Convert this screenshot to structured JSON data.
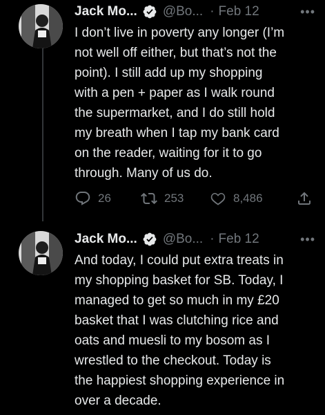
{
  "tweets": [
    {
      "author_name": "Jack Mo...",
      "handle": "@Bo...",
      "separator": "·",
      "date": "Feb 12",
      "more_label": "•••",
      "lines": [
        "I don’t live in poverty any longer (I’m",
        "not well off either, but that’s not the",
        "point). I still add up my shopping",
        "with a pen + paper as I walk round",
        "the supermarket, and I do still hold",
        "my breath when I tap my bank card",
        "on the reader, waiting for it to go",
        "through. Many of us do."
      ],
      "replies": "26",
      "retweets": "253",
      "likes": "8,486"
    },
    {
      "author_name": "Jack Mo...",
      "handle": "@Bo...",
      "separator": "·",
      "date": "Feb 12",
      "more_label": "•••",
      "lines": [
        "And today, I could put extra treats in",
        "my shopping basket for SB. Today, I",
        "managed to get so much in my £20",
        "basket that I was clutching rice and",
        "oats and muesli to my bosom as I",
        "wrestled to the checkout. Today is",
        "the happiest shopping experience in",
        "over a decade."
      ]
    }
  ],
  "icons": {
    "verified": "verified-badge-icon",
    "reply": "reply-icon",
    "retweet": "retweet-icon",
    "like": "like-icon",
    "share": "share-icon"
  },
  "colors": {
    "background": "#000000",
    "text": "#e7e9ea",
    "muted": "#71767b",
    "thread_line": "#333639"
  }
}
